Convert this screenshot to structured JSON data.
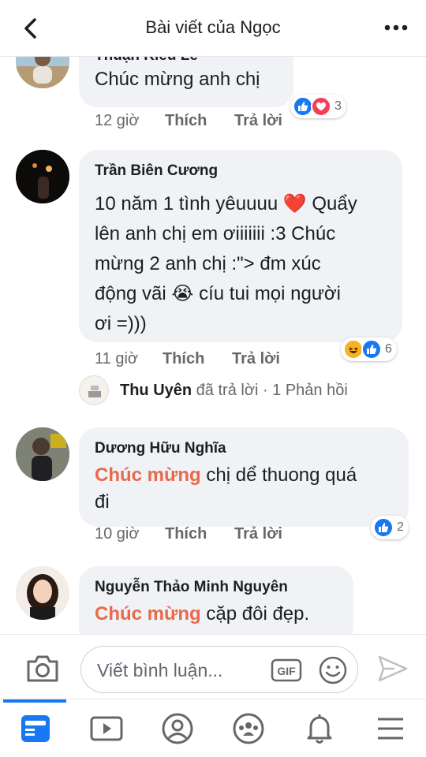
{
  "header": {
    "title": "Bài viết của Ngọc",
    "back_icon": "chevron-left-icon",
    "more_icon": "more-horizontal-icon"
  },
  "comments": [
    {
      "author": "Thuận Kiều Lê",
      "lines": [
        "Chúc mừng anh chị"
      ],
      "time": "12 giờ",
      "like_label": "Thích",
      "reply_label": "Trả lời",
      "reactions": [
        "like",
        "love"
      ],
      "reaction_count": "3"
    },
    {
      "author": "Trần Biên Cương",
      "lines": [
        "10 năm 1 tình yêuuuu ❤️ Quẩy",
        "lên anh chị em ơiiiiiii :3 Chúc",
        "mừng 2 anh chị :\"> đm xúc",
        "động vãi 😭 cíu tui mọi người",
        "ơi =)))"
      ],
      "time": "11 giờ",
      "like_label": "Thích",
      "reply_label": "Trả lời",
      "reactions": [
        "haha",
        "like"
      ],
      "reaction_count": "6",
      "reply_summary": {
        "author": "Thu Uyên",
        "action": " đã trả lời",
        "count_text": " · 1 Phản hồi"
      }
    },
    {
      "author": "Dương Hữu Nghĩa",
      "highlight": "Chúc mừng",
      "line1_rest": " chị dể thuong quá",
      "line2": "đi",
      "time": "10 giờ",
      "like_label": "Thích",
      "reply_label": "Trả lời",
      "reactions": [
        "like"
      ],
      "reaction_count": "2"
    },
    {
      "author": "Nguyễn Thảo Minh Nguyên",
      "highlight": "Chúc mừng",
      "line1_rest": " cặp đôi đẹp."
    }
  ],
  "composer": {
    "placeholder": "Viết bình luận...",
    "gif_label": "GIF",
    "camera_icon": "camera-icon",
    "emoji_icon": "smiley-icon",
    "send_icon": "send-icon"
  },
  "tabs": [
    {
      "icon": "news-feed-icon",
      "active": true
    },
    {
      "icon": "watch-video-icon",
      "active": false
    },
    {
      "icon": "profile-icon",
      "active": false
    },
    {
      "icon": "groups-icon",
      "active": false
    },
    {
      "icon": "notifications-bell-icon",
      "active": false
    },
    {
      "icon": "menu-icon",
      "active": false
    }
  ],
  "colors": {
    "accent_text": "#e9694a",
    "brand_blue": "#1877f2",
    "bubble_bg": "#f0f2f5",
    "love_red": "#f33e58",
    "haha_yellow": "#f7b125"
  }
}
